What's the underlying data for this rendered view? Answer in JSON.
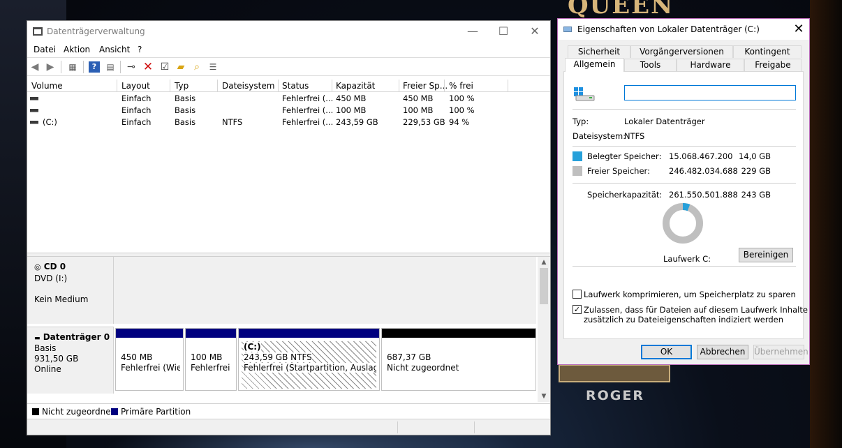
{
  "background": {
    "poster_title": "QUEEN",
    "poster_name": "ROGER"
  },
  "disk_mgmt": {
    "title": "Datenträgerverwaltung",
    "window_controls": {
      "minimize": "—",
      "maximize": "☐",
      "close": "✕"
    },
    "menu": [
      "Datei",
      "Aktion",
      "Ansicht",
      "?"
    ],
    "columns": [
      "Volume",
      "Layout",
      "Typ",
      "Dateisystem",
      "Status",
      "Kapazität",
      "Freier Sp...",
      "% frei"
    ],
    "rows": [
      {
        "volume": "",
        "layout": "Einfach",
        "typ": "Basis",
        "dateisystem": "",
        "status": "Fehlerfrei (...",
        "kapazitaet": "450 MB",
        "frei": "450 MB",
        "prozent": "100 %"
      },
      {
        "volume": "",
        "layout": "Einfach",
        "typ": "Basis",
        "dateisystem": "",
        "status": "Fehlerfrei (...",
        "kapazitaet": "100 MB",
        "frei": "100 MB",
        "prozent": "100 %"
      },
      {
        "volume": "(C:)",
        "layout": "Einfach",
        "typ": "Basis",
        "dateisystem": "NTFS",
        "status": "Fehlerfrei (...",
        "kapazitaet": "243,59 GB",
        "frei": "229,53 GB",
        "prozent": "94 %"
      }
    ],
    "cd": {
      "name": "CD 0",
      "type": "DVD (I:)",
      "media": "Kein Medium"
    },
    "disk0": {
      "name": "Datenträger 0",
      "type": "Basis",
      "size": "931,50 GB",
      "state": "Online"
    },
    "partitions": [
      {
        "line1": "450 MB",
        "line2": "Fehlerfrei (Wied"
      },
      {
        "line1": "100 MB",
        "line2": "Fehlerfrei (E"
      },
      {
        "line0": "(C:)",
        "line1": "243,59 GB NTFS",
        "line2": "Fehlerfrei (Startpartition, Auslagerur"
      },
      {
        "line1": "687,37 GB",
        "line2": "Nicht zugeordnet"
      }
    ],
    "legend": {
      "unallocated": "Nicht zugeordnet",
      "primary": "Primäre Partition"
    },
    "colors": {
      "primary_partition": "#00007f",
      "unallocated": "#000000"
    }
  },
  "properties": {
    "title": "Eigenschaften von Lokaler Datenträger (C:)",
    "close": "✕",
    "tabs_row1": [
      "Sicherheit",
      "Vorgängerversionen",
      "Kontingent"
    ],
    "tabs_row2": [
      "Allgemein",
      "Tools",
      "Hardware",
      "Freigabe"
    ],
    "name_value": "",
    "type_label": "Typ:",
    "type_value": "Lokaler Datenträger",
    "fs_label": "Dateisystem:",
    "fs_value": "NTFS",
    "used_label": "Belegter Speicher:",
    "used_bytes": "15.068.467.200",
    "used_gb": "14,0 GB",
    "free_label": "Freier Speicher:",
    "free_bytes": "246.482.034.688",
    "free_gb": "229 GB",
    "cap_label": "Speicherkapazität:",
    "cap_bytes": "261.550.501.888",
    "cap_gb": "243 GB",
    "drive_label": "Laufwerk C:",
    "cleanup_button": "Bereinigen",
    "compress_label": "Laufwerk komprimieren, um Speicherplatz zu sparen",
    "compress_checked": false,
    "index_label_1": "Zulassen, dass für Dateien auf diesem Laufwerk Inhalte",
    "index_label_2": "zusätzlich zu Dateieigenschaften indiziert werden",
    "index_checked": true,
    "used_fraction": 0.0576,
    "ok_button": "OK",
    "cancel_button": "Abbrechen",
    "apply_button": "Übernehmen",
    "colors": {
      "used": "#26a0da",
      "free": "#bfbfbf"
    }
  }
}
